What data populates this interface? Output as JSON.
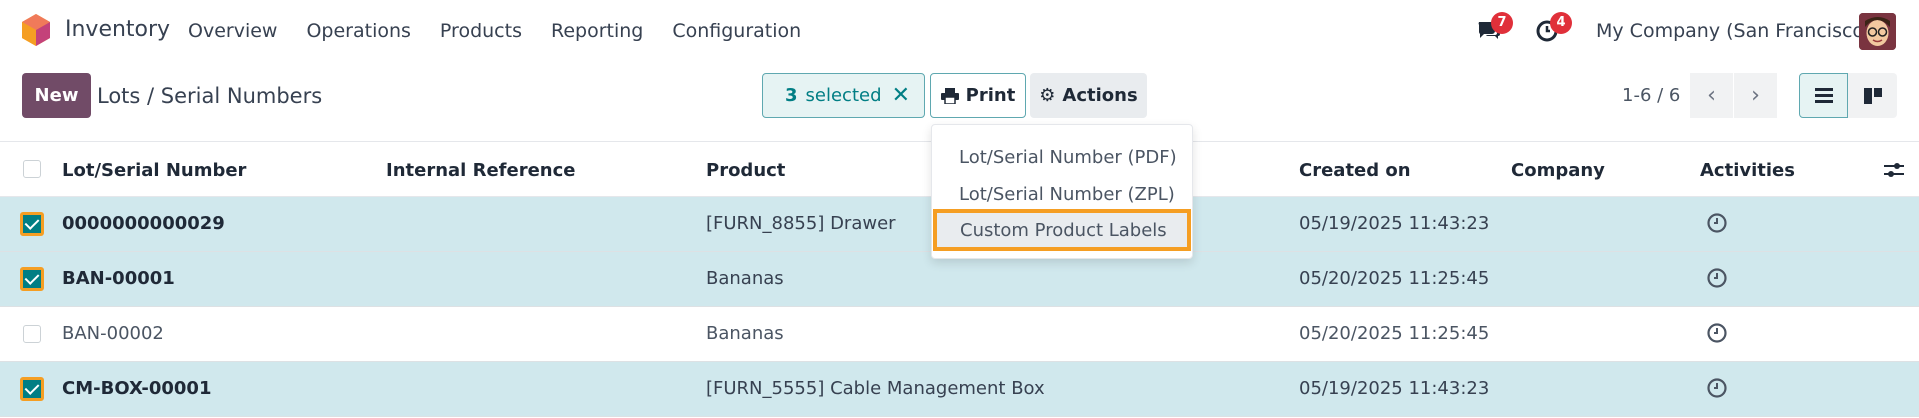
{
  "navbar": {
    "app_name": "Inventory",
    "menu": [
      "Overview",
      "Operations",
      "Products",
      "Reporting",
      "Configuration"
    ],
    "messages_badge": "7",
    "activities_badge": "4",
    "company": "My Company (San Francisco)"
  },
  "control_panel": {
    "new_label": "New",
    "breadcrumb": "Lots / Serial Numbers",
    "selected_count": "3",
    "selected_label": "selected",
    "print_label": "Print",
    "actions_label": "Actions",
    "pager": "1-6 / 6"
  },
  "print_menu": {
    "items": [
      "Lot/Serial Number (PDF)",
      "Lot/Serial Number (ZPL)",
      "Custom Product Labels"
    ]
  },
  "table": {
    "headers": [
      "Lot/Serial Number",
      "Internal Reference",
      "Product",
      "Created on",
      "Company",
      "Activities"
    ],
    "rows": [
      {
        "lot": "0000000000029",
        "product": "[FURN_8855] Drawer",
        "created": "05/19/2025 11:43:23",
        "selected": true
      },
      {
        "lot": "BAN-00001",
        "product": "Bananas",
        "created": "05/20/2025 11:25:45",
        "selected": true
      },
      {
        "lot": "BAN-00002",
        "product": "Bananas",
        "created": "05/20/2025 11:25:45",
        "selected": false
      },
      {
        "lot": "CM-BOX-00001",
        "product": "[FURN_5555] Cable Management Box",
        "created": "05/19/2025 11:43:23",
        "selected": true
      }
    ]
  },
  "colors": {
    "brand": "#714b67",
    "accent": "#017e84",
    "selected_row": "#d0e8ed",
    "highlight": "#f59e23",
    "badge": "#e0303a"
  }
}
